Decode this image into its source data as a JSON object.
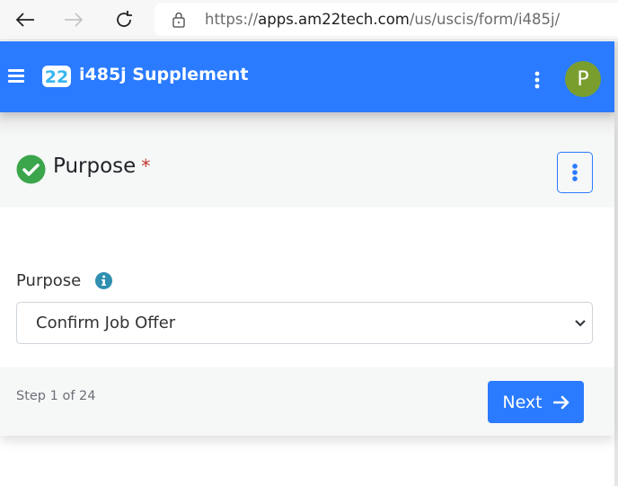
{
  "browser": {
    "url_scheme": "https://",
    "url_host": "apps.am22tech.com",
    "url_path": "/us/uscis/form/i485j/"
  },
  "header": {
    "logo_text": "22",
    "title": "i485j Supplement",
    "avatar_initial": "P",
    "brand_color": "#2a7bff",
    "avatar_color": "#7a9e2e"
  },
  "section": {
    "title": "Purpose",
    "required_marker": "*",
    "status": "complete"
  },
  "field": {
    "label": "Purpose",
    "selected_value": "Confirm Job Offer"
  },
  "footer": {
    "step_text": "Step 1 of 24",
    "next_label": "Next"
  }
}
